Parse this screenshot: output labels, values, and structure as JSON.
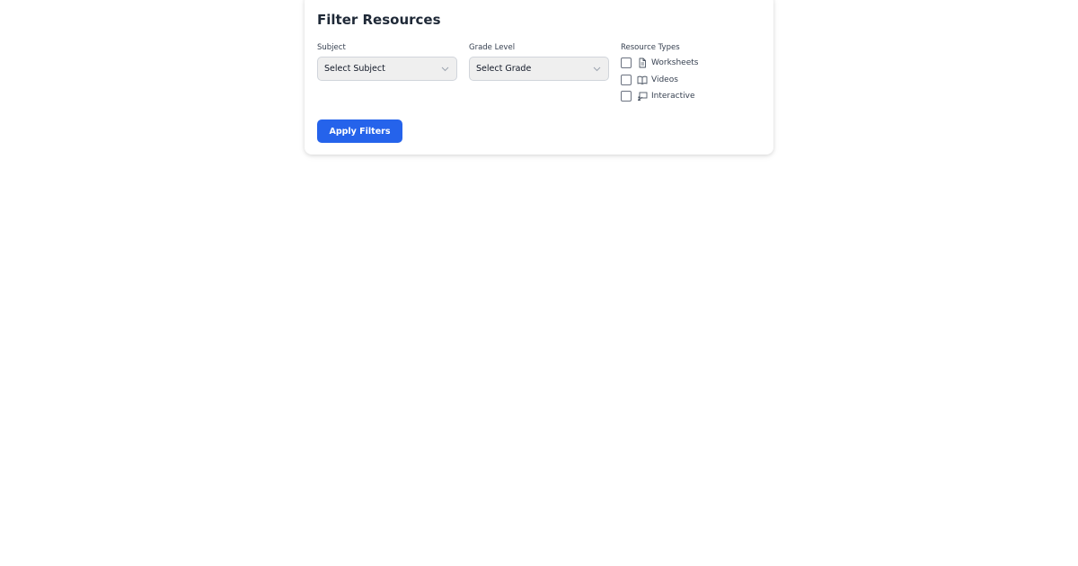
{
  "panel": {
    "title": "Filter Resources"
  },
  "filters": {
    "subject": {
      "label": "Subject",
      "selected": "Select Subject"
    },
    "grade": {
      "label": "Grade Level",
      "selected": "Select Grade"
    },
    "resource_types": {
      "label": "Resource Types",
      "options": [
        {
          "label": "Worksheets",
          "icon": "document-icon",
          "checked": false
        },
        {
          "label": "Videos",
          "icon": "book-open-icon",
          "checked": false
        },
        {
          "label": "Interactive",
          "icon": "presentation-icon",
          "checked": false
        }
      ]
    }
  },
  "actions": {
    "apply_label": "Apply Filters"
  },
  "colors": {
    "primary": "#2563eb",
    "select_bg": "#efefef",
    "text": "#1f2937"
  }
}
